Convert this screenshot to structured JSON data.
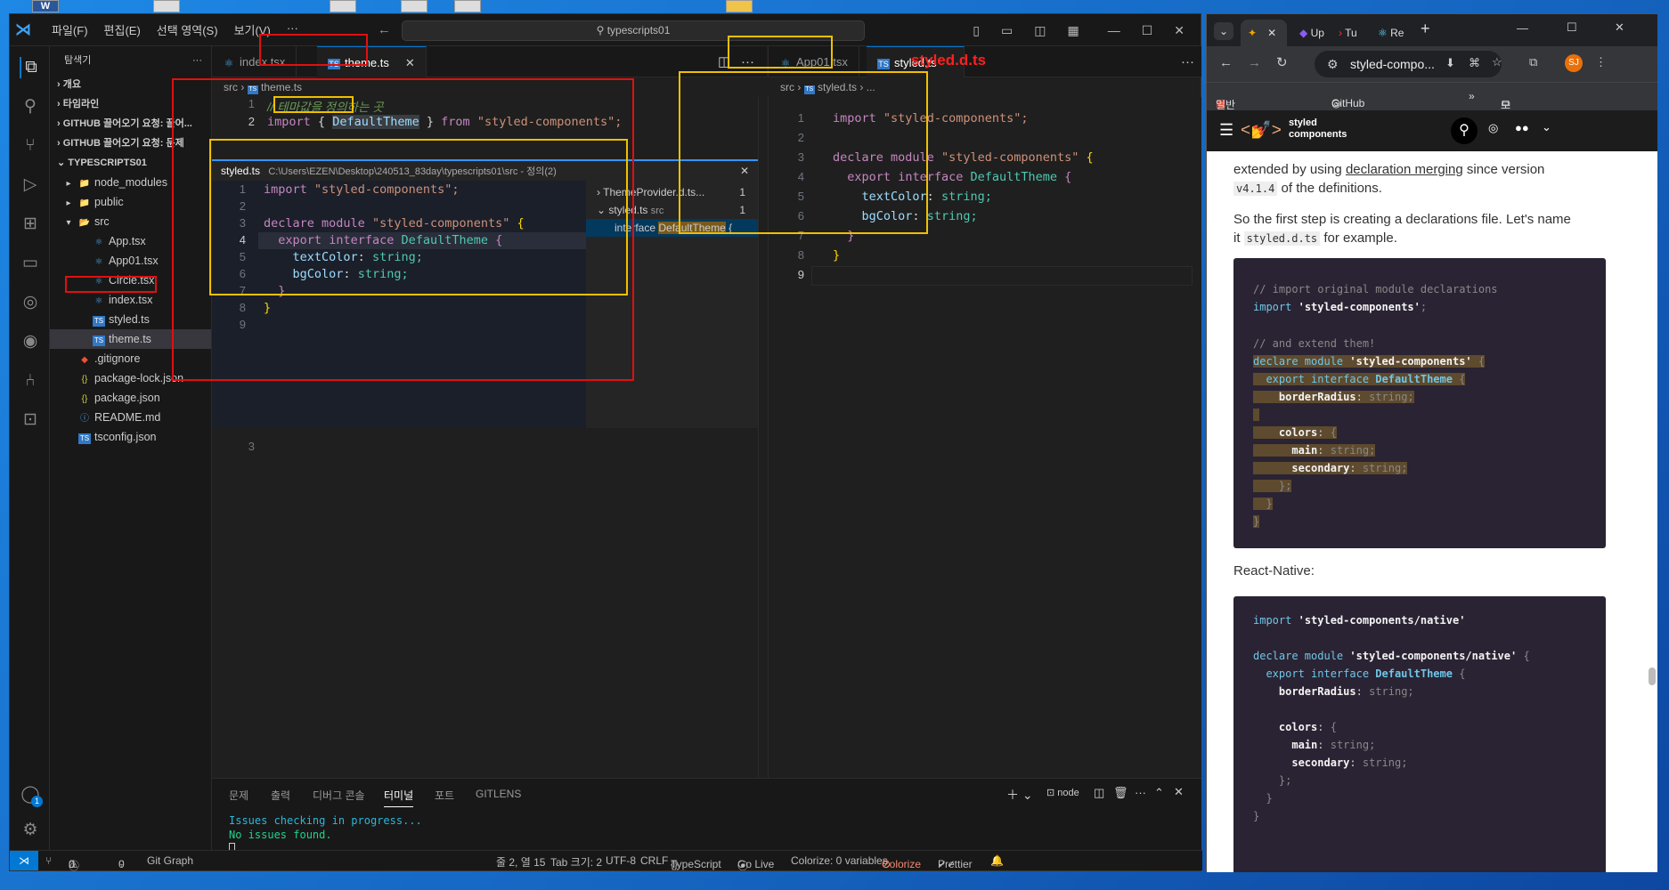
{
  "vscode": {
    "menu": [
      "파일(F)",
      "편집(E)",
      "선택 영역(S)",
      "보기(V)",
      "···"
    ],
    "command_center": "typescripts01",
    "sidebar": {
      "header": "탐색기",
      "sections": [
        "개요",
        "타임라인",
        "GITHUB 끌어오기 요청: 끌어...",
        "GITHUB 끌어오기 요청: 문제"
      ],
      "project": "TYPESCRIPTS01",
      "tree": [
        {
          "label": "node_modules",
          "kind": "folder",
          "indent": 1
        },
        {
          "label": "public",
          "kind": "folder",
          "indent": 1
        },
        {
          "label": "src",
          "kind": "folder-open",
          "indent": 1
        },
        {
          "label": "App.tsx",
          "kind": "tsx",
          "indent": 2
        },
        {
          "label": "App01.tsx",
          "kind": "tsx",
          "indent": 2
        },
        {
          "label": "Circle.tsx",
          "kind": "tsx",
          "indent": 2
        },
        {
          "label": "index.tsx",
          "kind": "tsx",
          "indent": 2
        },
        {
          "label": "styled.ts",
          "kind": "ts",
          "indent": 2
        },
        {
          "label": "theme.ts",
          "kind": "ts",
          "indent": 2
        },
        {
          "label": ".gitignore",
          "kind": "git",
          "indent": 1
        },
        {
          "label": "package-lock.json",
          "kind": "json",
          "indent": 1
        },
        {
          "label": "package.json",
          "kind": "json",
          "indent": 1
        },
        {
          "label": "README.md",
          "kind": "md",
          "indent": 1
        },
        {
          "label": "tsconfig.json",
          "kind": "tsconfig",
          "indent": 1
        }
      ]
    },
    "editor1": {
      "tabs": [
        "index.tsx",
        "theme.ts"
      ],
      "breadcrumb": {
        "folder": "src",
        "file": "theme.ts"
      },
      "line1_comment": "// 테마값을 정의하는 곳",
      "line2": {
        "import": "import",
        "brace_open": "{",
        "name": "DefaultTheme",
        "brace_close": "}",
        "from": "from",
        "module": "\"styled-components\";"
      },
      "peek": {
        "file": "styled.ts",
        "path": "C:\\Users\\EZEN\\Desktop\\240513_83day\\typescripts01\\src - 정의(2)",
        "refs": [
          {
            "label": "ThemeProvider.d.ts...",
            "count": "1"
          },
          {
            "label": "styled.ts",
            "sub": "src",
            "count": "1"
          }
        ],
        "ref_line": {
          "prefix": "interface",
          "name": "DefaultTheme",
          "suffix": "{"
        }
      },
      "after_peek_line": "3"
    },
    "editor2": {
      "tabs": [
        "App01.tsx",
        "styled.ts"
      ],
      "annotation": "styled.d.ts",
      "breadcrumb": {
        "folder": "src",
        "file": "styled.ts",
        "more": "..."
      }
    },
    "code_block": {
      "l1_import": "import",
      "l1_module": "\"styled-components\";",
      "l3_declare": "declare",
      "l3_module": "module",
      "l3_name": "\"styled-components\"",
      "brace": "{",
      "l4_export": "export",
      "l4_interface": "interface",
      "l4_name": "DefaultTheme",
      "l5_prop": "textColor",
      "l6_prop": "bgColor",
      "type_string": "string;",
      "close": "}"
    },
    "panel": {
      "tabs": [
        "문제",
        "출력",
        "디버그 콘솔",
        "터미널",
        "포트",
        "GITLENS"
      ],
      "active_tab": "터미널",
      "terminal_label": "node",
      "lines": [
        "Issues checking in progress...",
        "No issues found."
      ]
    },
    "status": {
      "errors": "0",
      "warnings": "0",
      "ports": "0",
      "git_graph": "Git Graph",
      "position": "줄 2, 열 15",
      "tab_size": "Tab 크기: 2",
      "encoding": "UTF-8",
      "eol": "CRLF",
      "language": "TypeScript",
      "golive": "Go Live",
      "colorize_vars": "Colorize: 0 variables",
      "colorize": "Colorize",
      "prettier": "Prettier"
    },
    "accounts_badge": "1"
  },
  "chrome": {
    "tabs": [
      "Up",
      "Tu",
      "Re"
    ],
    "url": "styled-compo...",
    "bookmarks": [
      "일반(채널) - WEB-U...",
      "GitHub",
      "모든 북마크"
    ],
    "avatar": "SJ",
    "site_logo_line1": "styled",
    "site_logo_line2": "components",
    "text1a": "extended by using",
    "text1_link": "declaration merging",
    "text1b": "since version",
    "version": "v4.1.4",
    "text1c": "of the definitions.",
    "text2": "So the first step is creating a declarations file. Let's name",
    "text3a": "it",
    "text3_code": "styled.d.ts",
    "text3b": "for example.",
    "code1": {
      "c1": "// import original module declarations",
      "c2_kw": "import",
      "c2_str": "'styled-components'",
      "c2_end": ";",
      "c3": "// and extend them!",
      "c4_kw": "declare module",
      "c4_str": "'styled-components'",
      "brace": "{",
      "c5_kw": "export interface",
      "c5_name": "DefaultTheme",
      "c6_prop": "borderRadius",
      "c6_type": "string;",
      "c8_prop": "colors",
      "c9_prop": "main",
      "c10_prop": "secondary",
      "close1": "};",
      "close2": "}",
      "close3": "}"
    },
    "text_rn": "React-Native:",
    "code2": {
      "c1_kw": "import",
      "c1_str": "'styled-components/native'",
      "c3_kw": "declare module",
      "c3_str": "'styled-components/native'",
      "brace": "{",
      "c4_kw": "export interface",
      "c4_name": "DefaultTheme",
      "c5_prop": "borderRadius",
      "c5_type": "string;",
      "c7_prop": "colors",
      "c8_prop": "main",
      "c9_prop": "secondary",
      "close1": "};",
      "close2": "}",
      "close3": "}"
    }
  }
}
